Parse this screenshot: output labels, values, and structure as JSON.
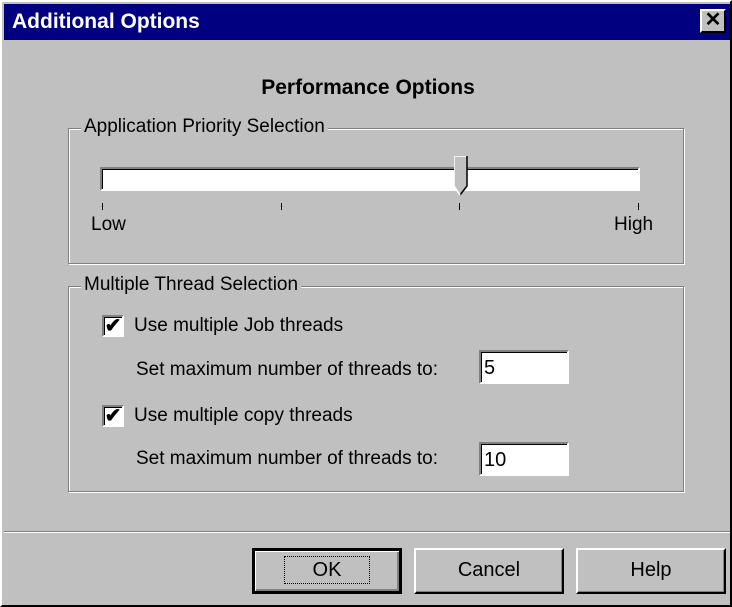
{
  "window": {
    "title": "Additional Options",
    "close_glyph": "✕"
  },
  "heading": "Performance Options",
  "priority": {
    "group_label": "Application Priority Selection",
    "low_label": "Low",
    "high_label": "High",
    "slider_value": 0.67,
    "tick_count": 4
  },
  "threads": {
    "group_label": "Multiple Thread Selection",
    "job_checkbox_label": "Use multiple Job threads",
    "job_checked": true,
    "job_max_label": "Set maximum number of threads to:",
    "job_max_value": "5",
    "copy_checkbox_label": "Use multiple copy threads",
    "copy_checked": true,
    "copy_max_label": "Set maximum number of threads to:",
    "copy_max_value": "10"
  },
  "buttons": {
    "ok": "OK",
    "cancel": "Cancel",
    "help": "Help"
  },
  "check_glyph": "✔"
}
